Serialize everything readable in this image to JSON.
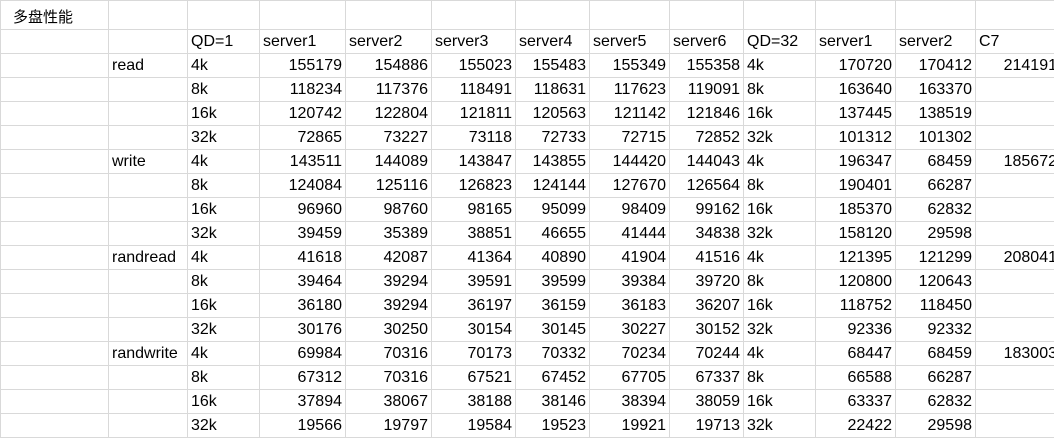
{
  "sheet": {
    "title": "多盘性能",
    "header": {
      "qd1": "QD=1",
      "s1": "server1",
      "s2": "server2",
      "s3": "server3",
      "s4": "server4",
      "s5": "server5",
      "s6": "server6",
      "qd32": "QD=32",
      "s1b": "server1",
      "s2b": "server2",
      "c7": "C7"
    },
    "rows": [
      {
        "op": "read",
        "bs": "4k",
        "v": [
          "155179",
          "154886",
          "155023",
          "155483",
          "155349",
          "155358"
        ],
        "bs2": "4k",
        "q1": "170720",
        "q2": "170412",
        "c7": "214191"
      },
      {
        "op": "",
        "bs": "8k",
        "v": [
          "118234",
          "117376",
          "118491",
          "118631",
          "117623",
          "119091"
        ],
        "bs2": "8k",
        "q1": "163640",
        "q2": "163370",
        "c7": ""
      },
      {
        "op": "",
        "bs": "16k",
        "v": [
          "120742",
          "122804",
          "121811",
          "120563",
          "121142",
          "121846"
        ],
        "bs2": "16k",
        "q1": "137445",
        "q2": "138519",
        "c7": ""
      },
      {
        "op": "",
        "bs": "32k",
        "v": [
          "72865",
          "73227",
          "73118",
          "72733",
          "72715",
          "72852"
        ],
        "bs2": "32k",
        "q1": "101312",
        "q2": "101302",
        "c7": ""
      },
      {
        "op": "write",
        "bs": "4k",
        "v": [
          "143511",
          "144089",
          "143847",
          "143855",
          "144420",
          "144043"
        ],
        "bs2": "4k",
        "q1": "196347",
        "q2": "68459",
        "c7": "185672"
      },
      {
        "op": "",
        "bs": "8k",
        "v": [
          "124084",
          "125116",
          "126823",
          "124144",
          "127670",
          "126564"
        ],
        "bs2": "8k",
        "q1": "190401",
        "q2": "66287",
        "c7": ""
      },
      {
        "op": "",
        "bs": "16k",
        "v": [
          "96960",
          "98760",
          "98165",
          "95099",
          "98409",
          "99162"
        ],
        "bs2": "16k",
        "q1": "185370",
        "q2": "62832",
        "c7": ""
      },
      {
        "op": "",
        "bs": "32k",
        "v": [
          "39459",
          "35389",
          "38851",
          "46655",
          "41444",
          "34838"
        ],
        "bs2": "32k",
        "q1": "158120",
        "q2": "29598",
        "c7": ""
      },
      {
        "op": "randread",
        "bs": "4k",
        "v": [
          "41618",
          "42087",
          "41364",
          "40890",
          "41904",
          "41516"
        ],
        "bs2": "4k",
        "q1": "121395",
        "q2": "121299",
        "c7": "208041"
      },
      {
        "op": "",
        "bs": "8k",
        "v": [
          "39464",
          "39294",
          "39591",
          "39599",
          "39384",
          "39720"
        ],
        "bs2": "8k",
        "q1": "120800",
        "q2": "120643",
        "c7": ""
      },
      {
        "op": "",
        "bs": "16k",
        "v": [
          "36180",
          "39294",
          "36197",
          "36159",
          "36183",
          "36207"
        ],
        "bs2": "16k",
        "q1": "118752",
        "q2": "118450",
        "c7": ""
      },
      {
        "op": "",
        "bs": "32k",
        "v": [
          "30176",
          "30250",
          "30154",
          "30145",
          "30227",
          "30152"
        ],
        "bs2": "32k",
        "q1": "92336",
        "q2": "92332",
        "c7": ""
      },
      {
        "op": "randwrite",
        "bs": "4k",
        "v": [
          "69984",
          "70316",
          "70173",
          "70332",
          "70234",
          "70244"
        ],
        "bs2": "4k",
        "q1": "68447",
        "q2": "68459",
        "c7": "183003"
      },
      {
        "op": "",
        "bs": "8k",
        "v": [
          "67312",
          "70316",
          "67521",
          "67452",
          "67705",
          "67337"
        ],
        "bs2": "8k",
        "q1": "66588",
        "q2": "66287",
        "c7": ""
      },
      {
        "op": "",
        "bs": "16k",
        "v": [
          "37894",
          "38067",
          "38188",
          "38146",
          "38394",
          "38059"
        ],
        "bs2": "16k",
        "q1": "63337",
        "q2": "62832",
        "c7": ""
      },
      {
        "op": "",
        "bs": "32k",
        "v": [
          "19566",
          "19797",
          "19584",
          "19523",
          "19921",
          "19713"
        ],
        "bs2": "32k",
        "q1": "22422",
        "q2": "29598",
        "c7": ""
      }
    ]
  }
}
